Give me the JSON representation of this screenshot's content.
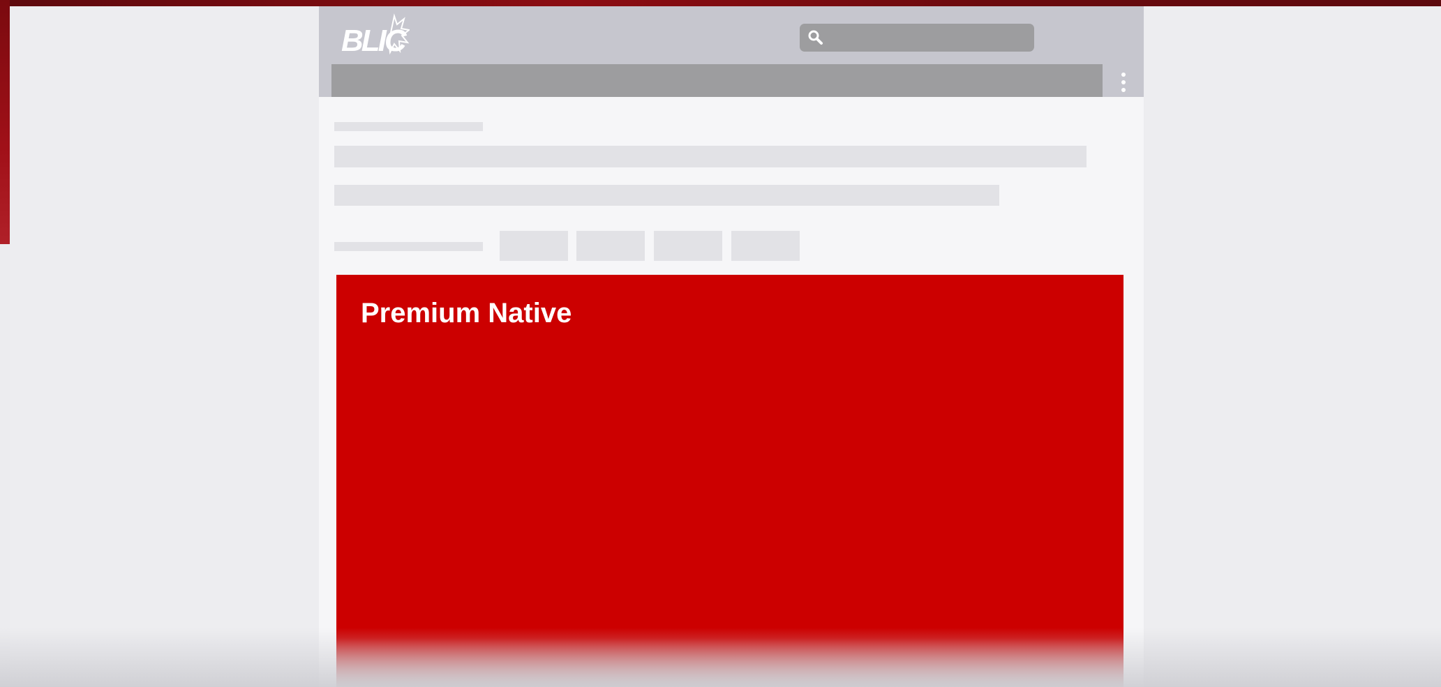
{
  "brand": {
    "logo_text": "BLIC",
    "logo_color": "#ffffff"
  },
  "header": {
    "search": {
      "icon": "search-icon"
    },
    "more_menu": {
      "icon": "more-vertical-icon"
    }
  },
  "ad": {
    "title": "Premium Native",
    "background_color": "#cc0000",
    "title_color": "#ffffff"
  },
  "colors": {
    "header_bg": "#c6c6ce",
    "bar_bg": "#9d9d9f",
    "page_bg": "#f6f6f8",
    "skeleton": "#e2e2e6",
    "backdrop_red": "#8c0d12"
  }
}
